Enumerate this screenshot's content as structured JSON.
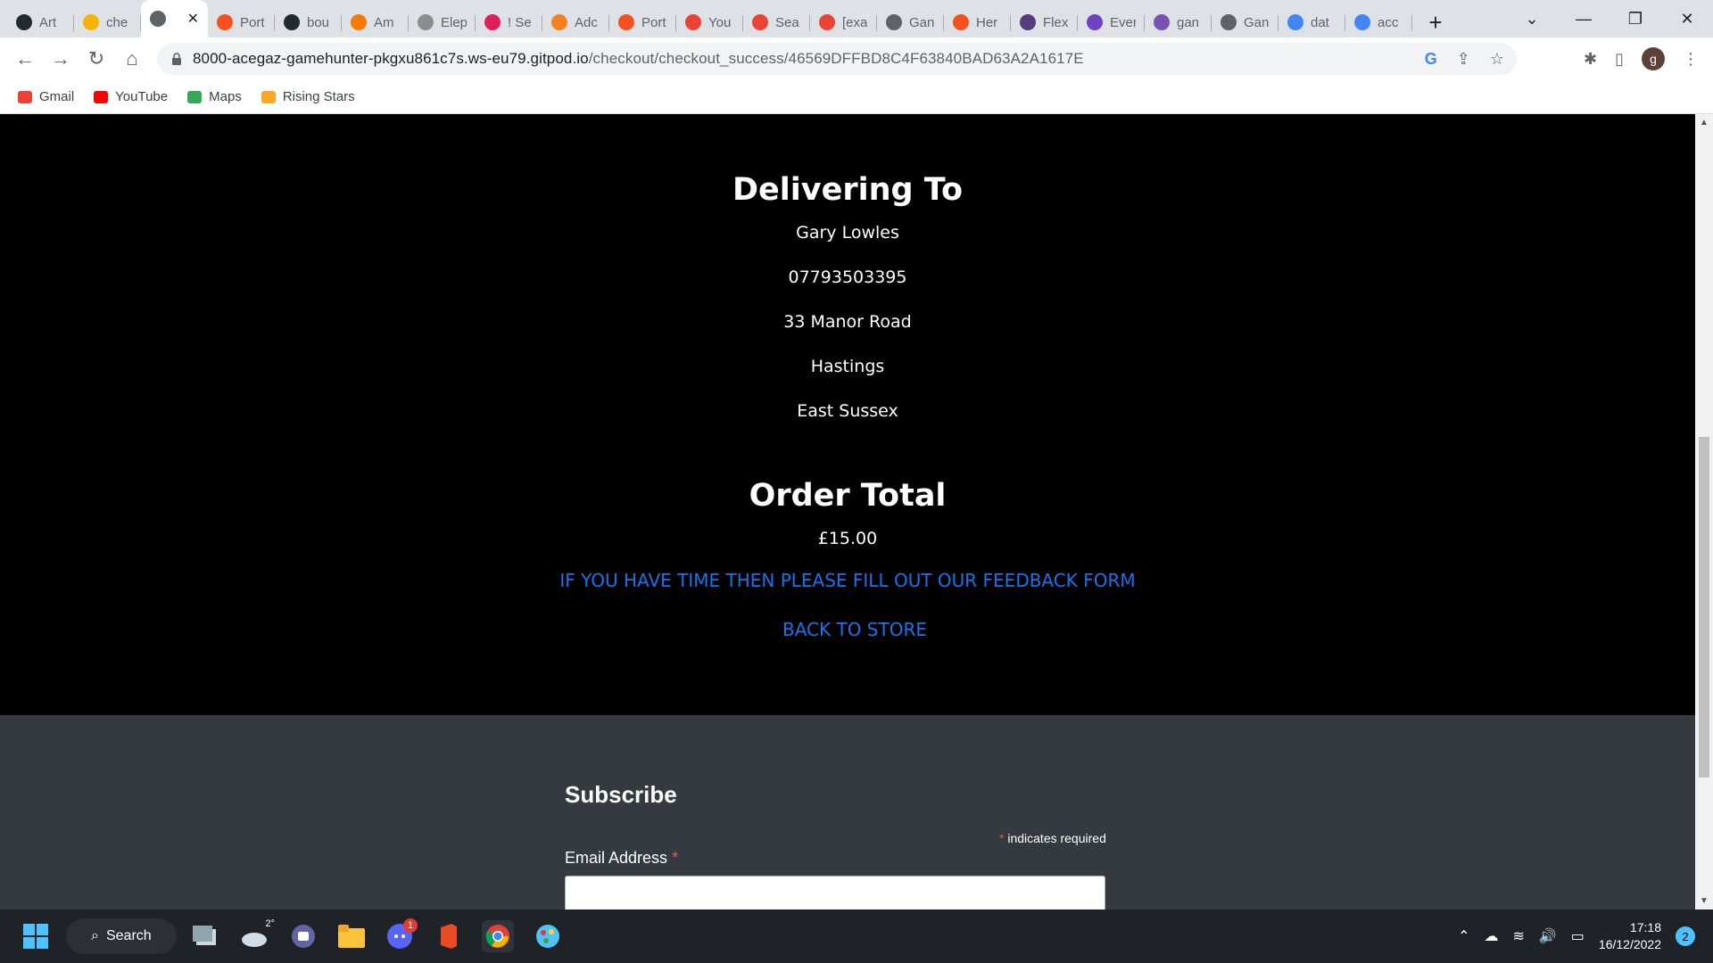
{
  "browser": {
    "tabs": [
      {
        "title": "Art",
        "icon": "github-icon",
        "color": "#24292f"
      },
      {
        "title": "che",
        "icon": "google-icon",
        "color": "#f4b400"
      },
      {
        "title": "",
        "icon": "globe-icon",
        "color": "#5f6368",
        "active": true
      },
      {
        "title": "Port",
        "icon": "circle-icon",
        "color": "#f4511e"
      },
      {
        "title": "bou",
        "icon": "github-icon",
        "color": "#24292f"
      },
      {
        "title": "Am",
        "icon": "box-icon",
        "color": "#f57c00"
      },
      {
        "title": "Elep",
        "icon": "elephant-icon",
        "color": "#8d8d8d"
      },
      {
        "title": "! Se",
        "icon": "slack-icon",
        "color": "#e01e5a"
      },
      {
        "title": "Adc",
        "icon": "stack-icon",
        "color": "#f48024"
      },
      {
        "title": "Port",
        "icon": "circle-icon",
        "color": "#f4511e"
      },
      {
        "title": "You",
        "icon": "gmail-icon",
        "color": "#ea4335"
      },
      {
        "title": "Sea",
        "icon": "gmail-icon",
        "color": "#ea4335"
      },
      {
        "title": "[exa",
        "icon": "gmail-icon",
        "color": "#ea4335"
      },
      {
        "title": "Gan",
        "icon": "globe-icon",
        "color": "#5f6368"
      },
      {
        "title": "Her",
        "icon": "circle-icon",
        "color": "#f4511e"
      },
      {
        "title": "Flex",
        "icon": "bootstrap-icon",
        "color": "#563d7c"
      },
      {
        "title": "Ever",
        "icon": "s-icon",
        "color": "#6f42c1"
      },
      {
        "title": "gan",
        "icon": "h-icon",
        "color": "#7952b3"
      },
      {
        "title": "Gan",
        "icon": "globe-icon",
        "color": "#5f6368"
      },
      {
        "title": "dat",
        "icon": "google-icon",
        "color": "#4285f4"
      },
      {
        "title": "acc",
        "icon": "google-icon",
        "color": "#4285f4"
      }
    ],
    "url_host": "8000-acegaz-gamehunter-pkgxu861c7s.ws-eu79.gitpod.io",
    "url_path": "/checkout/checkout_success/46569DFFBD8C4F63840BAD63A2A1617E",
    "profile_initial": "g",
    "bookmarks": [
      {
        "label": "Gmail",
        "icon": "gmail-icon"
      },
      {
        "label": "YouTube",
        "icon": "youtube-icon"
      },
      {
        "label": "Maps",
        "icon": "maps-icon"
      },
      {
        "label": "Rising Stars",
        "icon": "star-icon"
      }
    ]
  },
  "page": {
    "delivering_heading": "Delivering To",
    "name": "Gary Lowles",
    "phone": "07793503395",
    "address1": "33 Manor Road",
    "town": "Hastings",
    "county": "East Sussex",
    "total_heading": "Order Total",
    "total_value": "£15.00",
    "feedback_link": "If you have time then please fill out our feedback form",
    "back_link": "Back to store",
    "subscribe_heading": "Subscribe",
    "required_star": "*",
    "required_note": "indicates required",
    "email_label": "Email Address",
    "email_value": ""
  },
  "taskbar": {
    "search_label": "Search",
    "weather_temp": "2°",
    "discord_badge": "1",
    "time": "17:18",
    "date": "16/12/2022",
    "notifications": "2"
  }
}
